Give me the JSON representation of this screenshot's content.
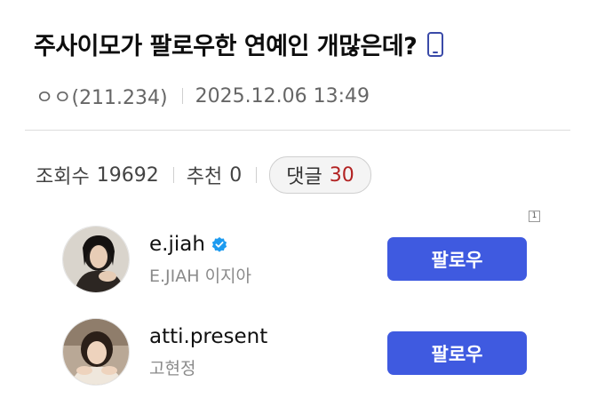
{
  "post": {
    "title": "주사이모가 팔로우한 연예인 개많은데?",
    "author": "ㅇㅇ(211.234)",
    "datetime": "2025.12.06 13:49",
    "views_label": "조회수",
    "views": "19692",
    "likes_label": "추천",
    "likes": "0",
    "comments_label": "댓글",
    "comments": "30",
    "title_icon": "mobile-phone-icon"
  },
  "embed": {
    "ad_badge": "1",
    "accounts": [
      {
        "handle": "e.jiah",
        "verified": true,
        "display_name": "E.JIAH 이지아",
        "follow_label": "팔로우"
      },
      {
        "handle": "atti.present",
        "verified": false,
        "display_name": "고현정",
        "follow_label": "팔로우"
      }
    ]
  },
  "colors": {
    "follow_button": "#3f5ae0",
    "comment_count": "#b22222",
    "verified_badge": "#1d9bf0"
  }
}
